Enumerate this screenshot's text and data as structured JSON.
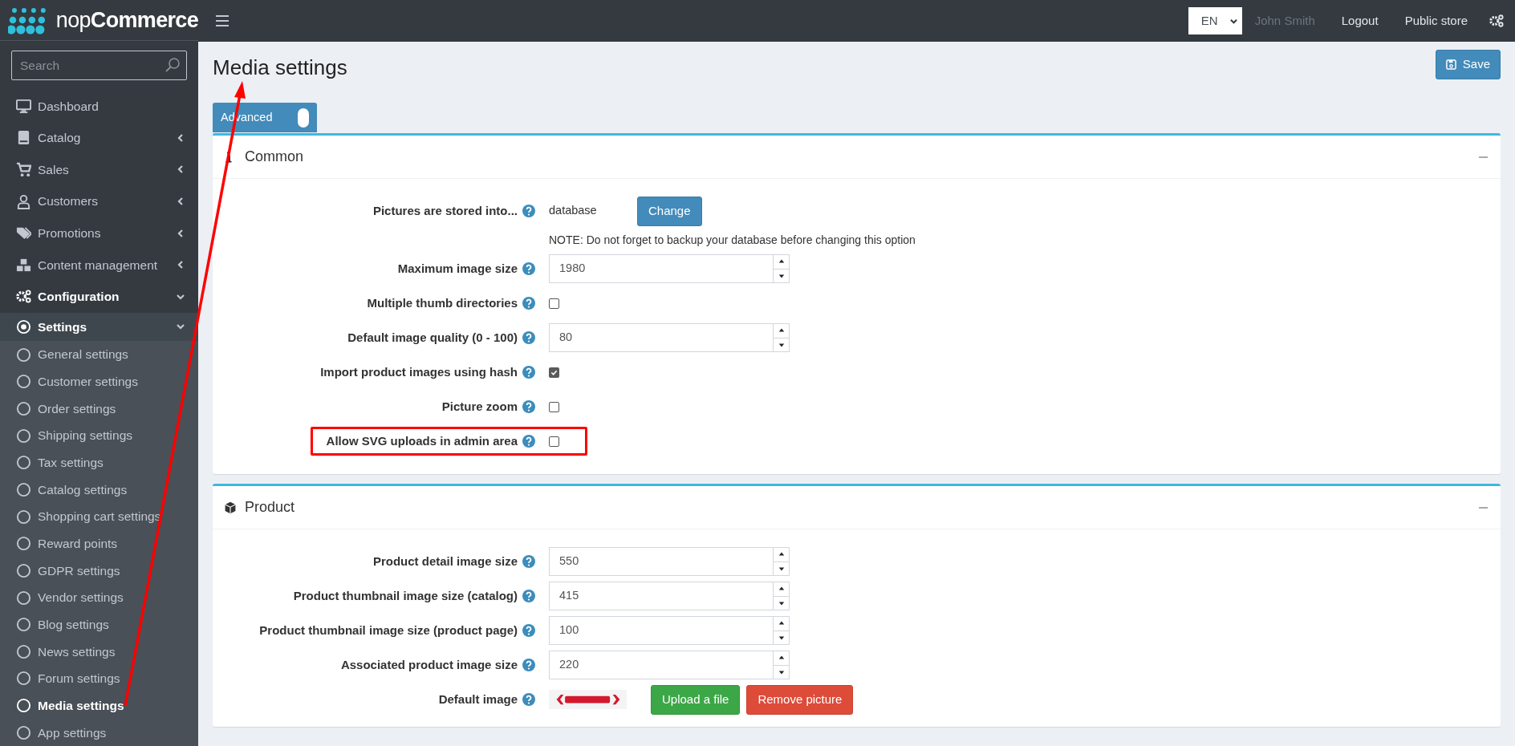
{
  "logo": {
    "light": "nop",
    "bold": "Commerce"
  },
  "sidebar": {
    "search": {
      "placeholder": "Search"
    },
    "items": [
      {
        "label": "Dashboard",
        "selected": false
      },
      {
        "label": "Catalog",
        "expanded": false
      },
      {
        "label": "Sales",
        "expanded": false
      },
      {
        "label": "Customers",
        "expanded": false
      },
      {
        "label": "Promotions",
        "expanded": false
      },
      {
        "label": "Content management",
        "expanded": false
      },
      {
        "label": "Configuration",
        "expanded": true,
        "children": [
          {
            "label": "Settings",
            "expanded": true,
            "children": [
              {
                "label": "General settings",
                "selected": false
              },
              {
                "label": "Customer settings",
                "selected": false
              },
              {
                "label": "Order settings",
                "selected": false
              },
              {
                "label": "Shipping settings",
                "selected": false
              },
              {
                "label": "Tax settings",
                "selected": false
              },
              {
                "label": "Catalog settings",
                "selected": false
              },
              {
                "label": "Shopping cart settings",
                "selected": false
              },
              {
                "label": "Reward points",
                "selected": false
              },
              {
                "label": "GDPR settings",
                "selected": false
              },
              {
                "label": "Vendor settings",
                "selected": false
              },
              {
                "label": "Blog settings",
                "selected": false
              },
              {
                "label": "News settings",
                "selected": false
              },
              {
                "label": "Forum settings",
                "selected": false
              },
              {
                "label": "Media settings",
                "selected": true
              },
              {
                "label": "App settings",
                "selected": false
              }
            ]
          }
        ]
      }
    ]
  },
  "topbar": {
    "language": "EN",
    "user": "John Smith",
    "links": [
      "Logout",
      "Public store"
    ]
  },
  "page": {
    "title": "Media settings",
    "save_label": "Save",
    "advanced": {
      "label": "Advanced",
      "on": true
    }
  },
  "cards": [
    {
      "title": "Common",
      "fields": [
        {
          "kind": "choice",
          "label": "Pictures are stored into...",
          "value": "database",
          "button": "Change",
          "note": "NOTE: Do not forget to backup your database before changing this option",
          "highlighted": false
        },
        {
          "kind": "number",
          "label": "Maximum image size",
          "value": "1980",
          "highlighted": false
        },
        {
          "kind": "checkbox",
          "label": "Multiple thumb directories",
          "checked": false,
          "highlighted": false
        },
        {
          "kind": "number",
          "label": "Default image quality (0 - 100)",
          "value": "80",
          "highlighted": false
        },
        {
          "kind": "checkbox",
          "label": "Import product images using hash",
          "checked": true,
          "highlighted": false
        },
        {
          "kind": "checkbox",
          "label": "Picture zoom",
          "checked": false,
          "highlighted": false
        },
        {
          "kind": "checkbox",
          "label": "Allow SVG uploads in admin area",
          "checked": false,
          "highlighted": true
        }
      ]
    },
    {
      "title": "Product",
      "fields": [
        {
          "kind": "number",
          "label": "Product detail image size",
          "value": "550",
          "highlighted": false
        },
        {
          "kind": "number",
          "label": "Product thumbnail image size (catalog)",
          "value": "415",
          "highlighted": false
        },
        {
          "kind": "number",
          "label": "Product thumbnail image size (product page)",
          "value": "100",
          "highlighted": false
        },
        {
          "kind": "number",
          "label": "Associated product image size",
          "value": "220",
          "highlighted": false
        },
        {
          "kind": "picture",
          "label": "Default image",
          "upload": "Upload a file",
          "remove": "Remove picture",
          "highlighted": false
        }
      ]
    }
  ],
  "annotations": [
    {
      "kind": "arrow"
    }
  ]
}
